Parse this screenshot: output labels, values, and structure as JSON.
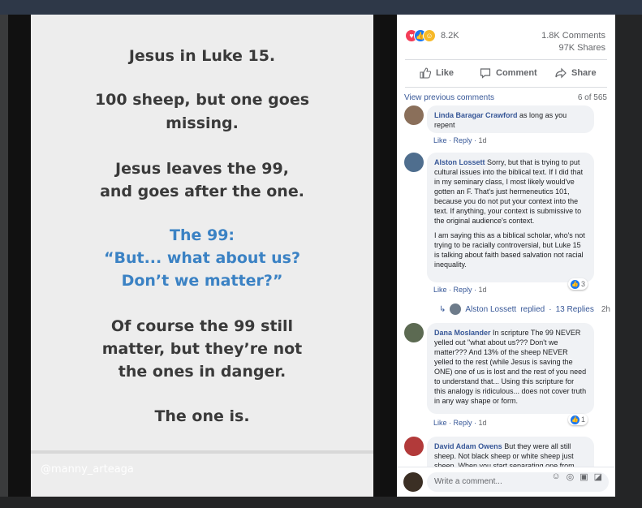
{
  "post": {
    "lines": [
      "Jesus in Luke 15.",
      "100 sheep, but one goes",
      "missing.",
      "Jesus leaves the 99,",
      "and goes after the one.",
      "The 99:",
      "“But... what about us?",
      "Don’t we matter?”",
      "Of course the 99 still",
      "matter, but they’re not",
      "the ones in danger.",
      "The one is."
    ],
    "handle": "@manny_arteaga",
    "text_color": "#3a3a3a",
    "accent_color": "#3b82c4"
  },
  "stats": {
    "reactions": "8.2K",
    "comments": "1.8K Comments",
    "shares": "97K Shares"
  },
  "actions": {
    "like": "Like",
    "comment": "Comment",
    "share": "Share"
  },
  "comments_header": {
    "view_previous": "View previous comments",
    "page": "6 of 565"
  },
  "comments": [
    {
      "name": "Linda Baragar Crawford",
      "text": "as long as you repent",
      "like": "Like",
      "reply": "Reply",
      "time": "1d"
    },
    {
      "name": "Alston Lossett",
      "text": "Sorry, but that is trying to put cultural issues into the biblical text. If I did that in my seminary class, I most likely would've gotten an F. That's just hermeneutics 101, because you do not put your context into the text. If anything, your context is submissive to the original audience's context.",
      "text2": "I am saying this as a biblical scholar, who's not trying to be racially controversial, but Luke 15 is talking about faith based salvation not racial inequality.",
      "like": "Like",
      "reply": "Reply",
      "time": "1d",
      "reactions": "3",
      "replies": {
        "name": "Alston Lossett",
        "label": "replied",
        "count": "13 Replies",
        "time": "2h"
      }
    },
    {
      "name": "Dana Moslander",
      "text": "In scripture The 99 NEVER yelled out \"what about us??? Don't we matter??? And 13% of the sheep NEVER yelled to the rest (while Jesus is saving the ONE) one of us is lost and the rest of you need to understand that... Using this scripture for this analogy is ridiculous... does not cover truth in any way shape or form.",
      "like": "Like",
      "reply": "Reply",
      "time": "1d",
      "reactions": "1"
    },
    {
      "name": "David Adam Owens",
      "text": "But they were all still sheep. Not black sheep or white sheep just sheep. When you start separating one from"
    }
  ],
  "composer": {
    "placeholder": "Write a comment..."
  },
  "colors": {
    "link": "#385898",
    "like_blue": "#1877f2",
    "love_red": "#f33e58",
    "care_yellow": "#f7b928"
  }
}
